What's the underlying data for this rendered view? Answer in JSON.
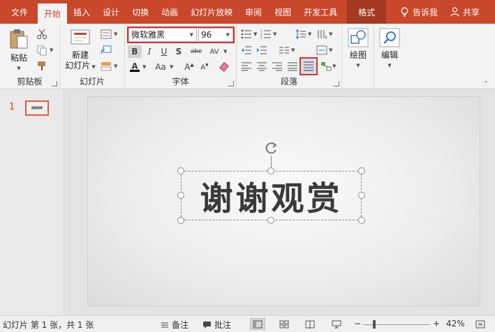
{
  "tabs": [
    {
      "label": "文件"
    },
    {
      "label": "开始"
    },
    {
      "label": "插入"
    },
    {
      "label": "设计"
    },
    {
      "label": "切换"
    },
    {
      "label": "动画"
    },
    {
      "label": "幻灯片放映"
    },
    {
      "label": "审阅"
    },
    {
      "label": "视图"
    },
    {
      "label": "开发工具"
    },
    {
      "label": "格式"
    }
  ],
  "tell_me": "告诉我",
  "share": "共享",
  "ribbon": {
    "clipboard": {
      "label": "剪贴板",
      "paste": "粘贴"
    },
    "slides": {
      "label": "幻灯片",
      "new_slide_line1": "新建",
      "new_slide_line2": "幻灯片"
    },
    "font": {
      "label": "字体",
      "font_name": "微软雅黑",
      "font_size": "96"
    },
    "paragraph": {
      "label": "段落"
    },
    "drawing": {
      "label": "绘图"
    },
    "editing": {
      "label": "编辑"
    }
  },
  "slide": {
    "number": "1",
    "thumb_text": "谢谢观赏",
    "text": "谢谢观赏"
  },
  "status": {
    "slide_info": "幻灯片 第 1 张，共 1 张",
    "notes": "备注",
    "comments": "批注",
    "zoom": "42%"
  },
  "colors": {
    "accent": "#c9472b",
    "highlight": "#d8312a"
  }
}
